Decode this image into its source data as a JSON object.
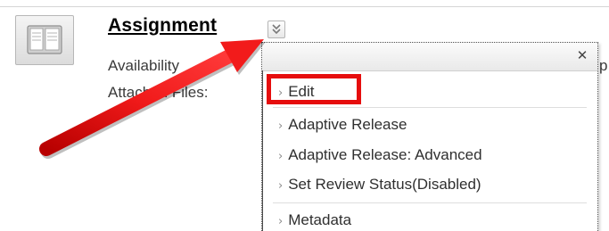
{
  "item": {
    "title": "Assignment",
    "availability_label": "Availability",
    "attached_files_label": "Attached Files:",
    "trailing_fragment": "p"
  },
  "menu": {
    "close_glyph": "✕",
    "items": [
      {
        "label": "Edit"
      },
      {
        "label": "Adaptive Release"
      },
      {
        "label": "Adaptive Release: Advanced"
      },
      {
        "label": "Set Review Status(Disabled)"
      },
      {
        "label": "Metadata"
      }
    ]
  },
  "annotation": {
    "highlight_color": "#e60d0d",
    "arrow_color": "#e60d0d"
  },
  "icons": {
    "item": "assignment-document-icon",
    "menu_toggle": "double-chevron-down-icon",
    "close": "close-icon",
    "arrow": "red-arrow-icon"
  }
}
